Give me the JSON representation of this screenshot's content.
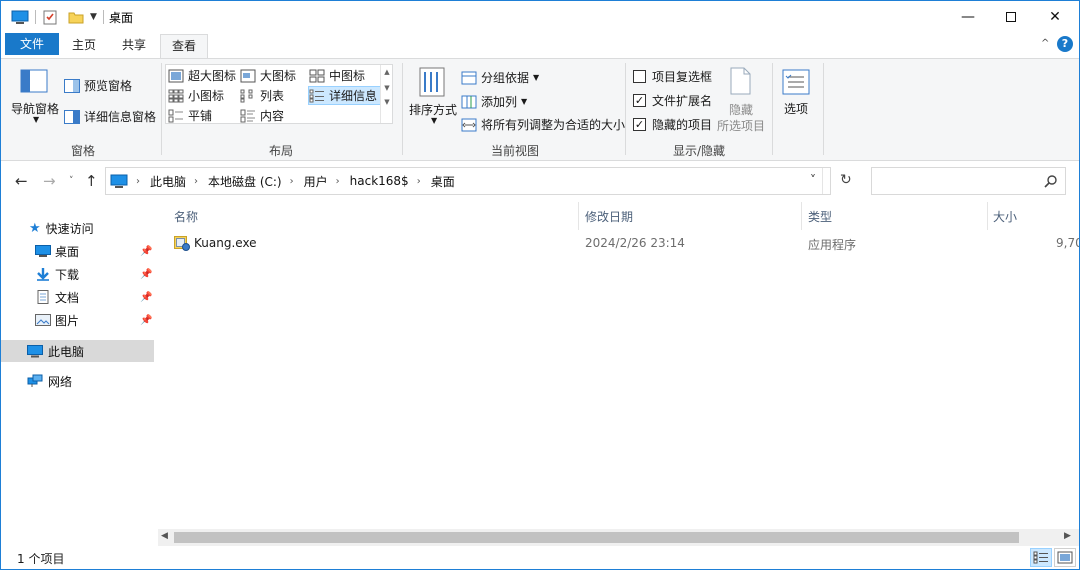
{
  "window": {
    "title": "桌面",
    "minimize_icon": "minimize-icon",
    "maximize_icon": "maximize-icon",
    "close_icon": "close-icon"
  },
  "ribbon_tabs": {
    "file": "文件",
    "home": "主页",
    "share": "共享",
    "view": "查看",
    "active": "查看"
  },
  "ribbon": {
    "panes": {
      "nav_pane": "导航窗格",
      "preview_pane": "预览窗格",
      "details_pane": "详细信息窗格",
      "group": "窗格"
    },
    "layout": {
      "items": [
        "超大图标",
        "大图标",
        "中图标",
        "小图标",
        "列表",
        "详细信息",
        "平铺",
        "内容"
      ],
      "selected": "详细信息",
      "group": "布局"
    },
    "current_view": {
      "sort_by": "排序方式",
      "group_by": "分组依据",
      "add_columns": "添加列",
      "size_columns": "将所有列调整为合适的大小",
      "group": "当前视图"
    },
    "show_hide": {
      "item_checkboxes": "项目复选框",
      "item_checkboxes_checked": false,
      "file_extensions": "文件扩展名",
      "file_extensions_checked": true,
      "hidden_items": "隐藏的项目",
      "hidden_items_checked": true,
      "hide_selected": "隐藏",
      "hide_selected_2": "所选项目",
      "group": "显示/隐藏"
    },
    "options": "选项"
  },
  "address": {
    "crumbs": [
      "此电脑",
      "本地磁盘 (C:)",
      "用户",
      "hack168$",
      "桌面"
    ],
    "search_placeholder": ""
  },
  "nav_pane": {
    "quick_access": "快速访问",
    "items": [
      "桌面",
      "下载",
      "文档",
      "图片"
    ],
    "this_pc": "此电脑",
    "network": "网络"
  },
  "file_list": {
    "columns": [
      "名称",
      "修改日期",
      "类型",
      "大小"
    ],
    "rows": [
      {
        "name": "Kuang.exe",
        "modified": "2024/2/26 23:14",
        "type": "应用程序",
        "size": "9,70"
      }
    ]
  },
  "status": {
    "count": "1 个项目"
  },
  "colors": {
    "accent": "#1979ca",
    "selection": "#cce8ff",
    "nav_selected": "#d9d9d9"
  }
}
